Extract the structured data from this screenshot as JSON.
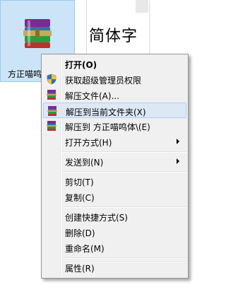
{
  "desktop": {
    "selected_file_label": "方正喵鸣",
    "font_file_preview": "简体字"
  },
  "menu": {
    "items": [
      {
        "label": "打开(O)"
      },
      {
        "label": "获取超级管理员权限"
      },
      {
        "label": "解压文件(A)..."
      },
      {
        "label": "解压到当前文件夹(X)"
      },
      {
        "label": "解压到 方正喵鸣体\\(E)"
      },
      {
        "label": "打开方式(H)"
      },
      {
        "label": "发送到(N)"
      },
      {
        "label": "剪切(T)"
      },
      {
        "label": "复制(C)"
      },
      {
        "label": "创建快捷方式(S)"
      },
      {
        "label": "删除(D)"
      },
      {
        "label": "重命名(M)"
      },
      {
        "label": "属性(R)"
      }
    ]
  },
  "icons": {
    "rar": "winrar-archive-icon",
    "shield": "uac-shield-icon",
    "submenu": "chevron-right-icon"
  }
}
